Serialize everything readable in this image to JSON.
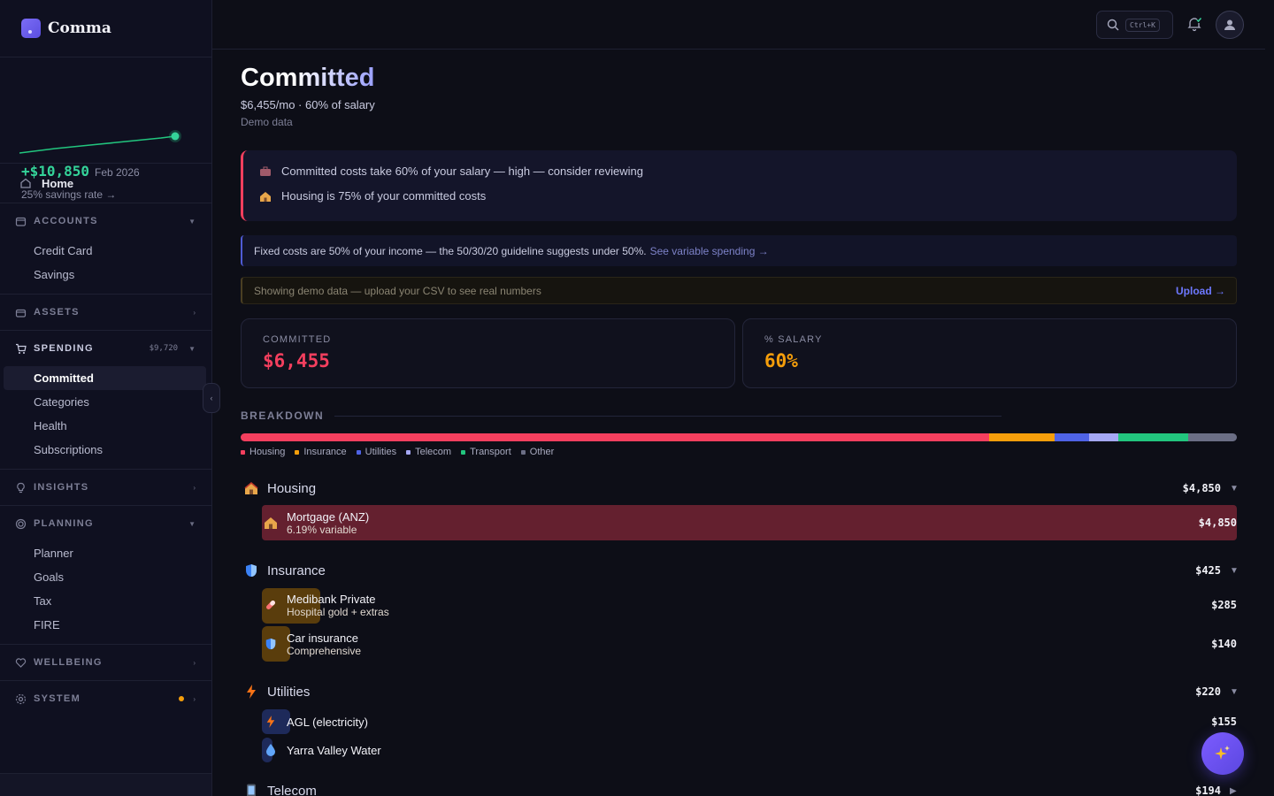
{
  "brand": {
    "name": "Comma"
  },
  "savings": {
    "amount": "+$10,850",
    "month": "Feb 2026",
    "rate_link": "25% savings rate →"
  },
  "nav": {
    "home": "Home",
    "accounts": {
      "title": "ACCOUNTS",
      "items": [
        "Credit Card",
        "Savings"
      ]
    },
    "assets": {
      "title": "ASSETS"
    },
    "spending": {
      "title": "SPENDING",
      "amount": "$9,720",
      "items": [
        "Committed",
        "Categories",
        "Health",
        "Subscriptions"
      ]
    },
    "insights": {
      "title": "INSIGHTS"
    },
    "planning": {
      "title": "PLANNING",
      "items": [
        "Planner",
        "Goals",
        "Tax",
        "FIRE"
      ]
    },
    "wellbeing": {
      "title": "WELLBEING"
    },
    "system": {
      "title": "SYSTEM"
    }
  },
  "topbar": {
    "search_shortcut": "Ctrl+K"
  },
  "page": {
    "title": "Committed",
    "subtitle": "$6,455/mo · 60% of salary",
    "demo": "Demo data"
  },
  "alerts": [
    "Committed costs take 60% of your salary — high — consider reviewing",
    "Housing is 75% of your committed costs"
  ],
  "info": {
    "text": "Fixed costs are 50% of your income — the 50/30/20 guideline suggests under 50%.",
    "link": "See variable spending →"
  },
  "demo_banner": {
    "text": "Showing demo data — upload your CSV to see real numbers",
    "link": "Upload →"
  },
  "stats": {
    "committed": {
      "label": "COMMITTED",
      "value": "$6,455",
      "color": "#f43f5e"
    },
    "salary": {
      "label": "% SALARY",
      "value": "60%",
      "color": "#f59e0b"
    }
  },
  "breakdown": {
    "title": "BREAKDOWN",
    "segments": [
      {
        "name": "Housing",
        "value": 4850,
        "color": "#f43f5e"
      },
      {
        "name": "Insurance",
        "value": 425,
        "color": "#f59e0b"
      },
      {
        "name": "Utilities",
        "value": 220,
        "color": "#4f63e6"
      },
      {
        "name": "Telecom",
        "value": 194,
        "color": "#a5a8f5"
      },
      {
        "name": "Transport",
        "value": 450,
        "color": "#22c57e"
      },
      {
        "name": "Other",
        "value": 316,
        "color": "#6b6e85"
      }
    ]
  },
  "categories": [
    {
      "name": "Housing",
      "amount": "$4,850",
      "toggle": "▼",
      "items": [
        {
          "name": "Mortgage (ANZ)",
          "sub": "6.19% variable",
          "amount": "$4,850"
        }
      ]
    },
    {
      "name": "Insurance",
      "amount": "$425",
      "toggle": "▼",
      "items": [
        {
          "name": "Medibank Private",
          "sub": "Hospital gold + extras",
          "amount": "$285"
        },
        {
          "name": "Car insurance",
          "sub": "Comprehensive",
          "amount": "$140"
        }
      ]
    },
    {
      "name": "Utilities",
      "amount": "$220",
      "toggle": "▼",
      "items": [
        {
          "name": "AGL (electricity)",
          "sub": "",
          "amount": "$155"
        },
        {
          "name": "Yarra Valley Water",
          "sub": "",
          "amount": ""
        }
      ]
    },
    {
      "name": "Telecom",
      "amount": "$194",
      "toggle": "▶",
      "items": []
    }
  ]
}
